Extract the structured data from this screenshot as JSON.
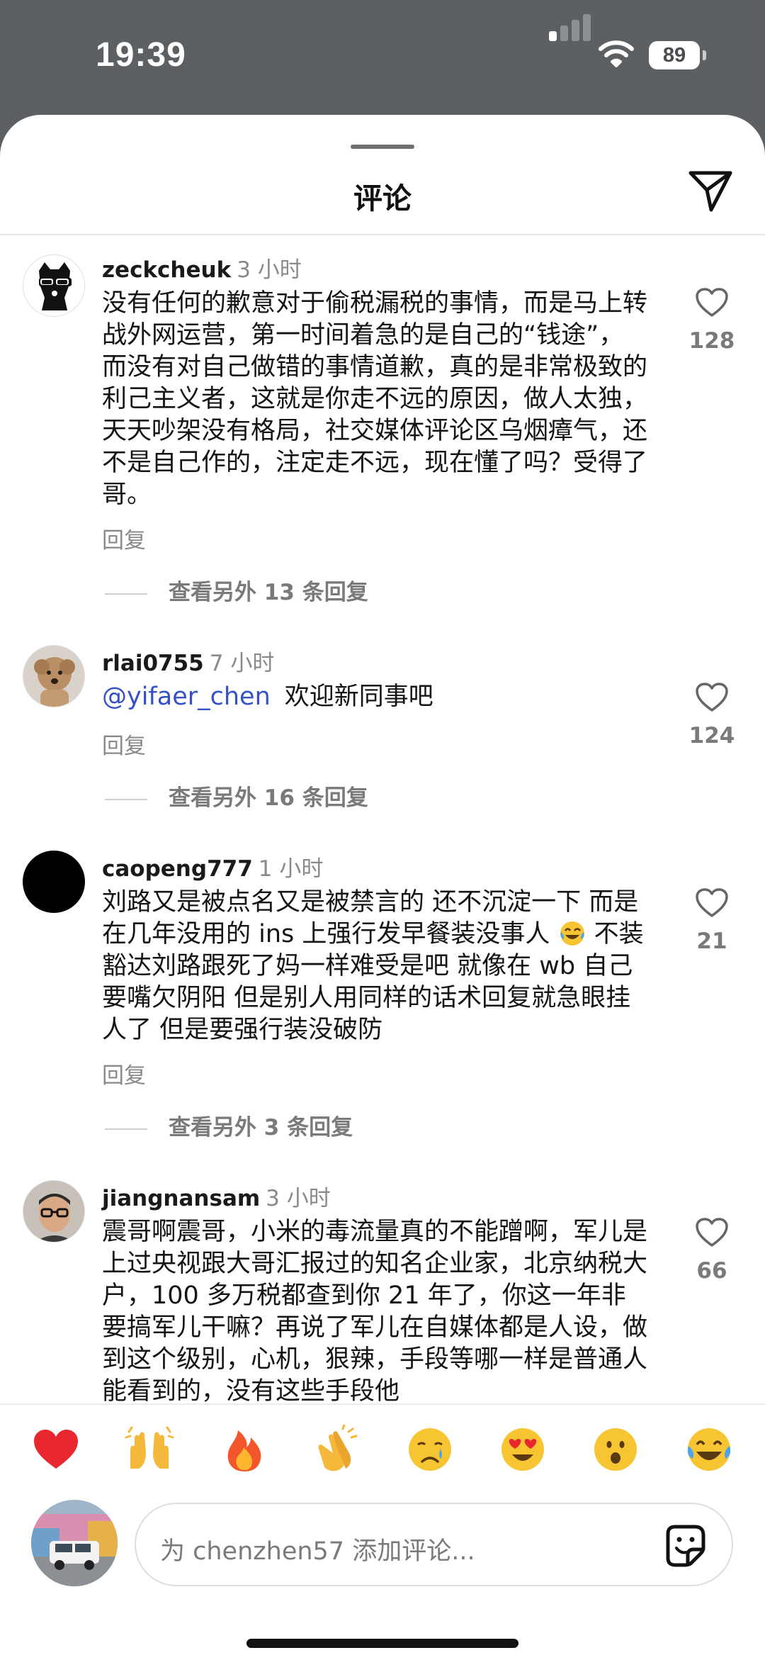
{
  "status_bar": {
    "time": "19:39",
    "battery": "89"
  },
  "sheet": {
    "title": "评论"
  },
  "comments": [
    {
      "username": "zeckcheuk",
      "time": "3 小时",
      "body": "没有任何的歉意对于偷税漏税的事情，而是马上转战外网运营，第一时间着急的是自己的“钱途”，而没有对自己做错的事情道歉，真的是非常极致的利己主义者，这就是你走不远的原因，做人太独，天天吵架没有格局，社交媒体评论区乌烟瘴气，还不是自己作的，注定走不远，现在懂了吗？受得了哥。",
      "reply_label": "回复",
      "likes": "128",
      "view_replies": "查看另外 13 条回复"
    },
    {
      "username": "rlai0755",
      "time": "7 小时",
      "mention": "@yifaer_chen",
      "body": "欢迎新同事吧",
      "reply_label": "回复",
      "likes": "124",
      "view_replies": "查看另外 16 条回复"
    },
    {
      "username": "caopeng777",
      "time": "1 小时",
      "body_part1": "刘路又是被点名又是被禁言的 还不沉淀一下 而是在几年没用的 ins 上强行发早餐装没事人",
      "body_part2": " 不装豁达刘路跟死了妈一样难受是吧 就像在 wb 自己要嘴欠阴阳 但是别人用同样的话术回复就急眼挂人了 但是要强行装没破防",
      "reply_label": "回复",
      "likes": "21",
      "view_replies": "查看另外 3 条回复"
    },
    {
      "username": "jiangnansam",
      "time": "3 小时",
      "body": "震哥啊震哥，小米的毒流量真的不能蹭啊，军儿是上过央视跟大哥汇报过的知名企业家，北京纳税大户，100 多万税都查到你 21 年了，你这一年非要搞军儿干嘛？再说了军儿在自媒体都是人设，做到这个级别，心机，狠辣，手段等哪一样是普通人能看到的，没有这些手段他",
      "likes": "66"
    }
  ],
  "emoji_bar": [
    "red-heart",
    "raising-hands",
    "fire",
    "clapping-hands",
    "crying-face",
    "heart-eyes",
    "surprised-face",
    "tears-of-joy"
  ],
  "input": {
    "placeholder": "为 chenzhen57 添加评论..."
  }
}
